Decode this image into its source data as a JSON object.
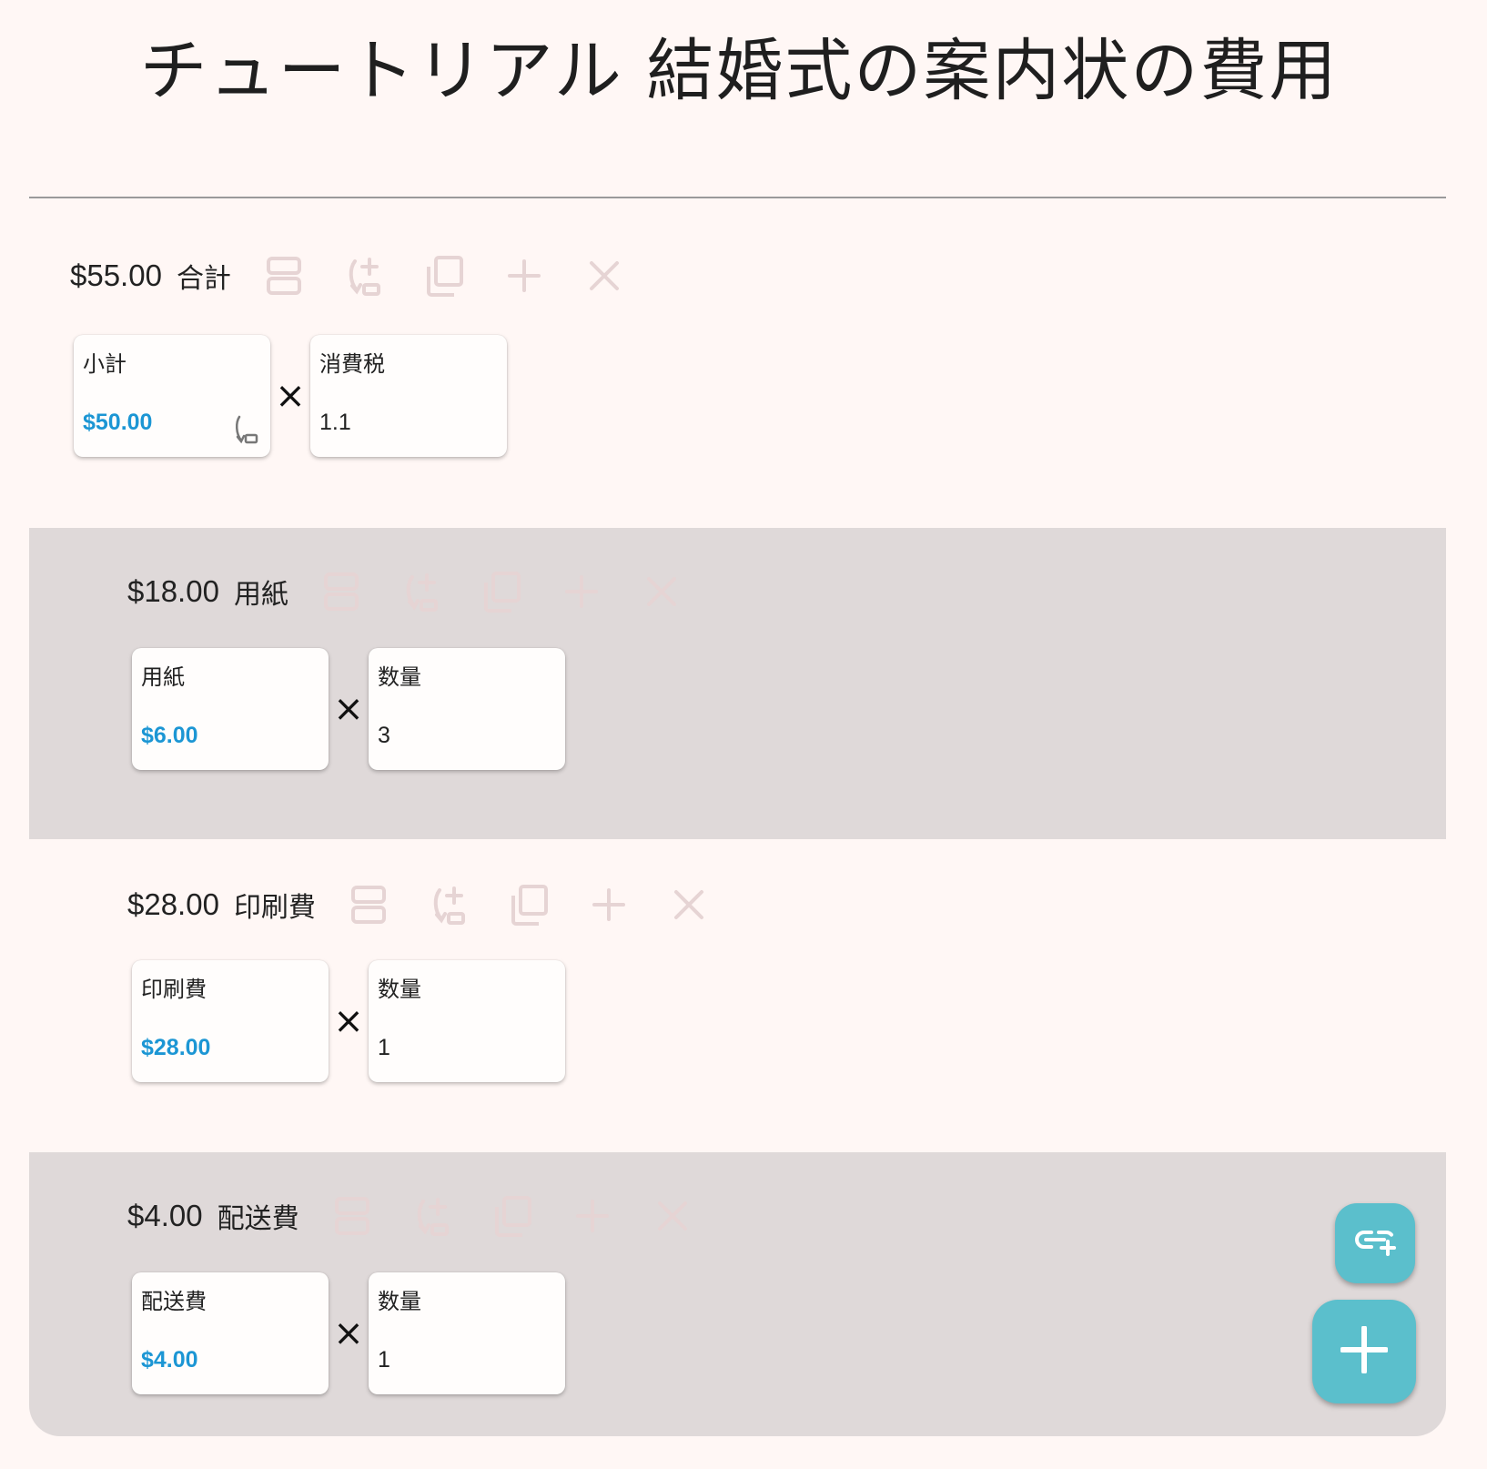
{
  "page": {
    "title": "チュートリアル 結婚式の案内状の費用"
  },
  "colors": {
    "background": "#fff7f5",
    "shaded": "#dfd9d9",
    "accent": "#5bbfcc",
    "value_blue": "#1c96d4",
    "tool_icon": "#e6d4d4"
  },
  "header_icons": [
    "split-icon",
    "link-add-icon",
    "copy-icon",
    "plus-icon",
    "close-icon"
  ],
  "sections": [
    {
      "amount": "$55.00",
      "name": "合計",
      "left": {
        "label": "小計",
        "value": "$50.00"
      },
      "operator": "×",
      "right": {
        "label": "消費税",
        "value": "1.1"
      }
    },
    {
      "amount": "$18.00",
      "name": "用紙",
      "left": {
        "label": "用紙",
        "value": "$6.00"
      },
      "operator": "×",
      "right": {
        "label": "数量",
        "value": "3"
      }
    },
    {
      "amount": "$28.00",
      "name": "印刷費",
      "left": {
        "label": "印刷費",
        "value": "$28.00"
      },
      "operator": "×",
      "right": {
        "label": "数量",
        "value": "1"
      }
    },
    {
      "amount": "$4.00",
      "name": "配送費",
      "left": {
        "label": "配送費",
        "value": "$4.00"
      },
      "operator": "×",
      "right": {
        "label": "数量",
        "value": "1"
      }
    }
  ],
  "fab": {
    "small_icon": "add-link-icon",
    "large_icon": "plus-icon"
  }
}
